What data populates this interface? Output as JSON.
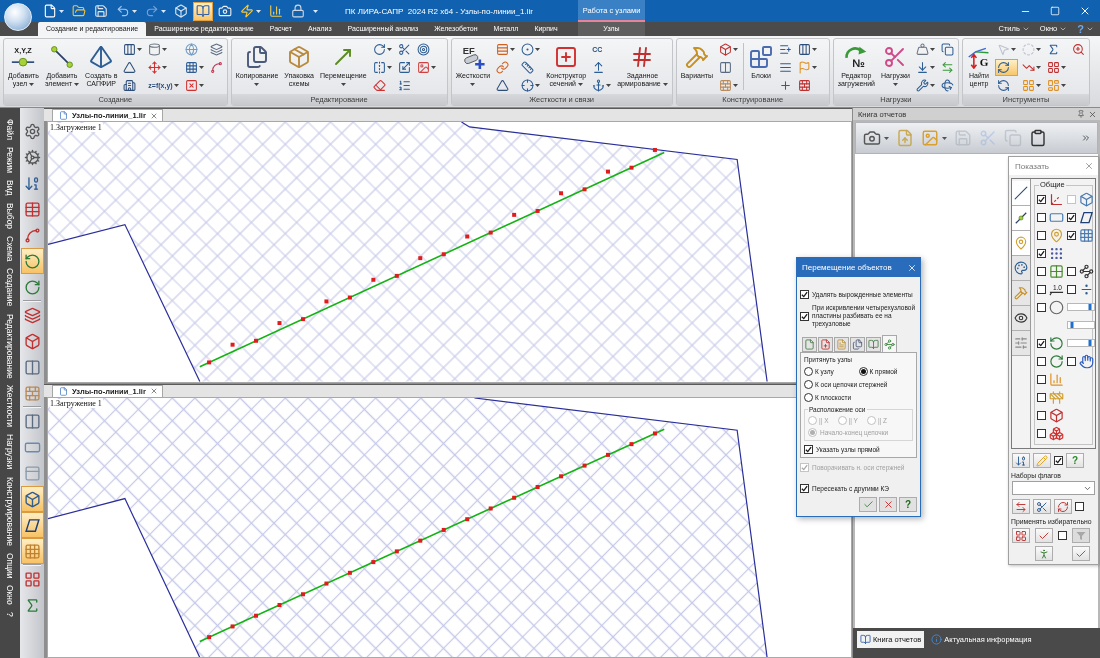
{
  "title_bar": {
    "title": "ПК ЛИРА-САПР  2024 R2 x64 - Узлы-по-линии_1.lir",
    "context_group": "Работа с узлами",
    "quick_access": [
      {
        "dropdown": true,
        "pressed": false
      },
      {
        "dropdown": false,
        "pressed": false
      },
      {
        "dropdown": false,
        "pressed": false
      },
      {
        "dropdown": true,
        "pressed": false
      },
      {
        "dropdown": true,
        "pressed": false
      },
      {
        "dropdown": false,
        "pressed": false
      },
      {
        "dropdown": false,
        "pressed": true
      },
      {
        "dropdown": false,
        "pressed": false
      },
      {
        "dropdown": true,
        "pressed": false
      },
      {
        "dropdown": false,
        "pressed": false
      },
      {
        "dropdown": false,
        "pressed": false
      }
    ]
  },
  "ribbon": {
    "tabs": [
      {
        "label": "Создание и редактирование",
        "selected": true,
        "kind": "standard"
      },
      {
        "label": "Расширенное редактирование",
        "selected": false,
        "kind": "standard"
      },
      {
        "label": "Расчет",
        "selected": false,
        "kind": "standard"
      },
      {
        "label": "Анализ",
        "selected": false,
        "kind": "standard"
      },
      {
        "label": "Расширенный анализ",
        "selected": false,
        "kind": "standard"
      },
      {
        "label": "Железобетон",
        "selected": false,
        "kind": "standard"
      },
      {
        "label": "Металл",
        "selected": false,
        "kind": "standard"
      },
      {
        "label": "Кирпич",
        "selected": false,
        "kind": "standard"
      },
      {
        "label": "Узлы",
        "selected": false,
        "kind": "context"
      }
    ],
    "menus": [
      {
        "label": "Стиль",
        "kind": "text"
      },
      {
        "label": "Окно",
        "kind": "text"
      },
      {
        "label": "?",
        "kind": "help"
      }
    ],
    "groups": [
      {
        "label": "Создание",
        "items": [
          {
            "kind": "large",
            "label": "Добавить узел",
            "dropdown": true,
            "icon_text": "X,Y,Z"
          },
          {
            "kind": "large",
            "label": "Добавить элемент",
            "dropdown": true
          },
          {
            "kind": "large",
            "label": "Создать в САПФИР",
            "dropdown": false
          },
          {
            "kind": "stack",
            "tools": [
              {
                "dropdown": true
              },
              {
                "dropdown": false
              },
              {
                "dropdown": false
              }
            ]
          },
          {
            "kind": "stack",
            "tools": [
              {
                "dropdown": true
              },
              {
                "dropdown": true
              },
              {
                "dropdown": true,
                "text": "z=f(x,y)"
              }
            ]
          },
          {
            "kind": "stack",
            "tools": [
              {
                "dropdown": false
              },
              {
                "dropdown": true
              },
              {
                "dropdown": true
              }
            ]
          },
          {
            "kind": "stack",
            "tools": [
              {
                "dropdown": false
              },
              {
                "dropdown": false
              }
            ]
          }
        ]
      },
      {
        "label": "Редактирование",
        "items": [
          {
            "kind": "large",
            "label": "Копирование",
            "dropdown": true
          },
          {
            "kind": "large",
            "label": "Упаковка схемы",
            "dropdown": false
          },
          {
            "kind": "large",
            "label": "Перемещение",
            "dropdown": true
          },
          {
            "kind": "stack",
            "tools": [
              {
                "dropdown": true
              },
              {
                "dropdown": true
              },
              {
                "dropdown": false
              }
            ]
          },
          {
            "kind": "stack",
            "tools": [
              {
                "dropdown": false
              },
              {
                "dropdown": false
              },
              {
                "dropdown": false
              }
            ]
          },
          {
            "kind": "stack",
            "tools": [
              {
                "dropdown": false
              },
              {
                "dropdown": true
              }
            ]
          }
        ]
      },
      {
        "label": "Жесткости и связи",
        "items": [
          {
            "kind": "large",
            "label": "Жесткости",
            "dropdown": true,
            "icon_text": "EF"
          },
          {
            "kind": "stack",
            "tools": [
              {
                "dropdown": true
              },
              {
                "dropdown": false
              },
              {
                "dropdown": false
              }
            ]
          },
          {
            "kind": "stack",
            "tools": [
              {
                "dropdown": true
              },
              {
                "dropdown": false
              },
              {
                "dropdown": true
              }
            ]
          },
          {
            "kind": "large",
            "label": "Конструктор сечений",
            "dropdown": true
          },
          {
            "kind": "stack",
            "tools": [
              {
                "dropdown": false,
                "text": "CC"
              },
              {
                "dropdown": false
              },
              {
                "dropdown": true
              }
            ]
          },
          {
            "kind": "large",
            "label": "Заданное армирование",
            "dropdown": true
          }
        ]
      },
      {
        "label": "Конструирование",
        "items": [
          {
            "kind": "large",
            "label": "Варианты",
            "dropdown": false
          },
          {
            "kind": "stack",
            "tools": [
              {
                "dropdown": true
              },
              {
                "dropdown": false
              },
              {
                "dropdown": true
              }
            ]
          },
          {
            "kind": "separator"
          },
          {
            "kind": "large",
            "label": "Блоки",
            "dropdown": false
          },
          {
            "kind": "stack",
            "tools": [
              {
                "dropdown": false
              },
              {
                "dropdown": false
              },
              {
                "dropdown": false
              }
            ]
          },
          {
            "kind": "stack",
            "tools": [
              {
                "dropdown": true
              },
              {
                "dropdown": true
              },
              {
                "dropdown": false
              }
            ]
          }
        ]
      },
      {
        "label": "Нагрузки",
        "items": [
          {
            "kind": "large",
            "label": "Редактор загружений",
            "dropdown": false,
            "icon_text": "№"
          },
          {
            "kind": "large",
            "label": "Нагрузки",
            "dropdown": true
          },
          {
            "kind": "stack",
            "tools": [
              {
                "dropdown": true
              },
              {
                "dropdown": true
              },
              {
                "dropdown": true
              }
            ]
          },
          {
            "kind": "stack",
            "tools": [
              {
                "dropdown": false
              },
              {
                "dropdown": false
              },
              {
                "dropdown": false
              }
            ]
          }
        ]
      },
      {
        "label": "Инструменты",
        "items": [
          {
            "kind": "large",
            "label": "Найти центр",
            "dropdown": false,
            "icon_text": "G"
          },
          {
            "kind": "stack",
            "tools": [
              {
                "dropdown": true,
                "pressed": false,
                "disabled": true
              },
              {
                "dropdown": false,
                "pressed": true,
                "disabled": false
              },
              {
                "dropdown": false,
                "pressed": false,
                "disabled": false
              }
            ]
          },
          {
            "kind": "stack",
            "tools": [
              {
                "dropdown": true,
                "pressed": false,
                "disabled": true
              },
              {
                "dropdown": true,
                "pressed": false,
                "disabled": false
              },
              {
                "dropdown": true,
                "pressed": false,
                "disabled": false
              }
            ]
          },
          {
            "kind": "stack",
            "tools": [
              {
                "dropdown": false,
                "pressed": false,
                "disabled": false
              },
              {
                "dropdown": true,
                "pressed": false,
                "disabled": false
              },
              {
                "dropdown": true,
                "pressed": false,
                "disabled": false
              }
            ]
          },
          {
            "kind": "stack",
            "tools": [
              {
                "dropdown": false,
                "pressed": false,
                "disabled": false
              }
            ]
          }
        ]
      }
    ]
  },
  "side_menu": [
    "Файл",
    "Режим",
    "Вид",
    "Выбор",
    "Схема",
    "Создание",
    "Редактирование",
    "Жесткости",
    "Нагрузки",
    "Конструирование",
    "Опции",
    "Окно",
    "?"
  ],
  "left_toolbar": [
    {
      "kind": "button",
      "pressed": false
    },
    {
      "kind": "button",
      "pressed": false
    },
    {
      "kind": "button",
      "pressed": false
    },
    {
      "kind": "button",
      "pressed": false
    },
    {
      "kind": "button",
      "pressed": false
    },
    {
      "kind": "button",
      "pressed": true
    },
    {
      "kind": "button",
      "pressed": false
    },
    {
      "kind": "separator"
    },
    {
      "kind": "button",
      "pressed": false
    },
    {
      "kind": "button",
      "pressed": false
    },
    {
      "kind": "button",
      "pressed": false
    },
    {
      "kind": "button",
      "pressed": false
    },
    {
      "kind": "separator"
    },
    {
      "kind": "button",
      "pressed": false
    },
    {
      "kind": "button",
      "pressed": false
    },
    {
      "kind": "button",
      "pressed": false
    },
    {
      "kind": "button",
      "pressed": true
    },
    {
      "kind": "button",
      "pressed": true
    },
    {
      "kind": "button",
      "pressed": true
    },
    {
      "kind": "separator"
    },
    {
      "kind": "button",
      "pressed": false
    },
    {
      "kind": "button",
      "pressed": false
    }
  ],
  "documents": [
    {
      "tab": "Узлы-по-линии_1.lir",
      "load_case": "1.Загружение 1"
    },
    {
      "tab": "Узлы-по-линии_1.lir",
      "load_case": "1.Загружение 1"
    }
  ],
  "report_panel": {
    "title": "Книга отчетов",
    "toolbar": [
      {
        "dropdown": true,
        "disabled": false
      },
      {
        "dropdown": false,
        "disabled": false
      },
      {
        "dropdown": true,
        "disabled": false
      },
      {
        "dropdown": false,
        "disabled": true
      },
      {
        "dropdown": false,
        "disabled": true
      },
      {
        "dropdown": false,
        "disabled": true
      },
      {
        "dropdown": false,
        "disabled": false
      }
    ],
    "tabs": [
      {
        "label": "Книга отчетов",
        "selected": true
      },
      {
        "label": "Актуальная информация",
        "selected": false
      }
    ]
  },
  "display_panel": {
    "title": "Показать",
    "categories": [
      {
        "selected": true
      },
      {
        "selected": true
      },
      {
        "selected": true
      },
      {
        "selected": false
      },
      {
        "selected": false
      },
      {
        "selected": false
      },
      {
        "selected": false
      }
    ],
    "group": "Общие",
    "rows": [
      {
        "items": [
          {
            "kind": "check",
            "checked": true,
            "disabled": false
          },
          {
            "kind": "check",
            "checked": false,
            "disabled": true
          }
        ]
      },
      {
        "items": [
          {
            "kind": "check",
            "checked": false,
            "disabled": false
          },
          {
            "kind": "check",
            "checked": true,
            "disabled": false
          }
        ]
      },
      {
        "items": [
          {
            "kind": "check",
            "checked": false,
            "disabled": false
          },
          {
            "kind": "check",
            "checked": true,
            "disabled": false
          }
        ]
      },
      {
        "items": [
          {
            "kind": "check",
            "checked": true,
            "disabled": false
          }
        ]
      },
      {
        "items": [
          {
            "kind": "check",
            "checked": false,
            "disabled": false
          },
          {
            "kind": "check",
            "checked": false,
            "disabled": false
          }
        ]
      },
      {
        "items": [
          {
            "kind": "check",
            "checked": false,
            "disabled": false,
            "icon_text": "1.0"
          },
          {
            "kind": "check",
            "checked": false,
            "disabled": false
          }
        ]
      },
      {
        "items": [
          {
            "kind": "check",
            "checked": false,
            "disabled": false
          },
          {
            "kind": "slider",
            "level": 0.85
          }
        ]
      },
      {
        "items": [
          {
            "kind": "slider",
            "level": 0.15
          }
        ]
      },
      {
        "items": [
          {
            "kind": "check",
            "checked": true,
            "disabled": false
          },
          {
            "kind": "slider",
            "level": 0.85
          }
        ]
      },
      {
        "items": [
          {
            "kind": "check",
            "checked": false,
            "disabled": false
          },
          {
            "kind": "check",
            "checked": false,
            "disabled": false
          }
        ]
      },
      {
        "items": [
          {
            "kind": "check",
            "checked": false,
            "disabled": false
          }
        ]
      },
      {
        "items": [
          {
            "kind": "check",
            "checked": false,
            "disabled": false
          }
        ]
      },
      {
        "items": [
          {
            "kind": "check",
            "checked": false,
            "disabled": false
          }
        ]
      },
      {
        "items": [
          {
            "kind": "check",
            "checked": false,
            "disabled": false
          }
        ]
      }
    ],
    "toolbar": [
      {
        "kind": "button"
      },
      {
        "kind": "button"
      },
      {
        "kind": "check",
        "checked": true
      },
      {
        "kind": "button",
        "label": "?"
      }
    ],
    "flag_sets": {
      "label": "Наборы флагов"
    },
    "flag_tools": [
      {
        "kind": "button"
      },
      {
        "kind": "button"
      },
      {
        "kind": "button"
      },
      {
        "kind": "check",
        "checked": false
      }
    ],
    "apply": {
      "label": "Применять избирательно"
    },
    "apply_tools": [
      {
        "kind": "button",
        "disabled": false
      },
      {
        "kind": "button",
        "disabled": false
      },
      {
        "kind": "check",
        "checked": false
      },
      {
        "kind": "button",
        "disabled": true
      },
      {
        "kind": "button",
        "disabled": false
      },
      {
        "kind": "button",
        "disabled": false
      }
    ]
  },
  "move_dialog": {
    "title": "Перемещение объектов",
    "options": [
      {
        "label": "Удалять вырожденные элементы",
        "checked": true
      },
      {
        "label": "При искривлении четырехузловой пластины разбивать ее на трехузловые",
        "checked": true
      }
    ],
    "tabs": [
      {
        "selected": false
      },
      {
        "selected": false
      },
      {
        "selected": false
      },
      {
        "selected": false
      },
      {
        "selected": false
      },
      {
        "selected": true
      }
    ],
    "snap_group": {
      "label": "Притянуть узлы",
      "options": [
        {
          "label": "К узлу",
          "selected": false
        },
        {
          "label": "К прямой",
          "selected": true
        },
        {
          "label": "К оси цепочки стержней",
          "selected": false
        },
        {
          "label": "К плоскости",
          "selected": false
        }
      ]
    },
    "axis_group": {
      "label": "Расположение оси",
      "disabled": true,
      "axes": [
        {
          "label": "|| X",
          "selected": false
        },
        {
          "label": "|| Y",
          "selected": false
        },
        {
          "label": "|| Z",
          "selected": false
        }
      ],
      "chain": {
        "label": "Начало-конец цепочки",
        "selected": true
      }
    },
    "show_line_nodes": {
      "label": "Указать узлы прямой",
      "checked": true
    },
    "rotate_axes": {
      "label": "Поворачивать н. оси стержней",
      "checked": true,
      "disabled": true
    },
    "intersect": {
      "label": "Пересекать с другими КЭ",
      "checked": true
    },
    "buttons": [
      {
        "kind": "ok"
      },
      {
        "kind": "cancel"
      },
      {
        "kind": "help",
        "label": "?"
      }
    ]
  }
}
